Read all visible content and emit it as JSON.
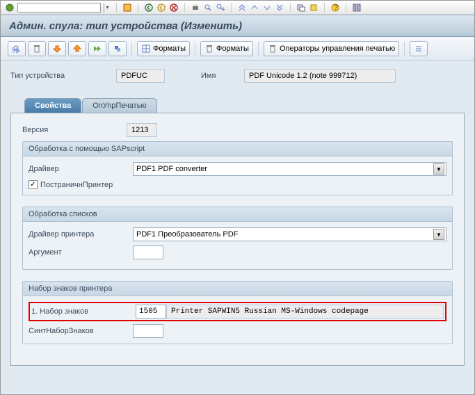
{
  "window_title": "Админ. спула: тип устройства (Изменить)",
  "toolbar_buttons": {
    "formats1": "Форматы",
    "formats2": "Форматы",
    "print_operators": "Операторы управления печатью"
  },
  "header": {
    "device_type_label": "Тип устройства",
    "device_type_value": "PDFUC",
    "name_label": "Имя",
    "name_value": "PDF Unicode 1.2  (note 999712)"
  },
  "tabs": {
    "properties": "Свойства",
    "print_ops": "ОпУпрПечатью"
  },
  "props": {
    "version_label": "Версия",
    "version_value": "1213",
    "sapscript_group": "Обработка с помощью SAPscript",
    "driver_label": "Драйвер",
    "driver_value": "PDF1 PDF converter",
    "page_printer_label": "ПостраничнПринтер",
    "lists_group": "Обработка списков",
    "printer_driver_label": "Драйвер принтера",
    "printer_driver_value": "PDF1 Преобразователь PDF",
    "argument_label": "Аргумент",
    "argument_value": "",
    "charset_group": "Набор знаков принтера",
    "charset1_label": "1.  Набор знаков",
    "charset1_code": "1505",
    "charset1_desc": "Printer SAPWIN5  Russian MS-Windows codepage",
    "synth_charset_label": "СинтНаборЗнаков",
    "synth_charset_value": ""
  }
}
